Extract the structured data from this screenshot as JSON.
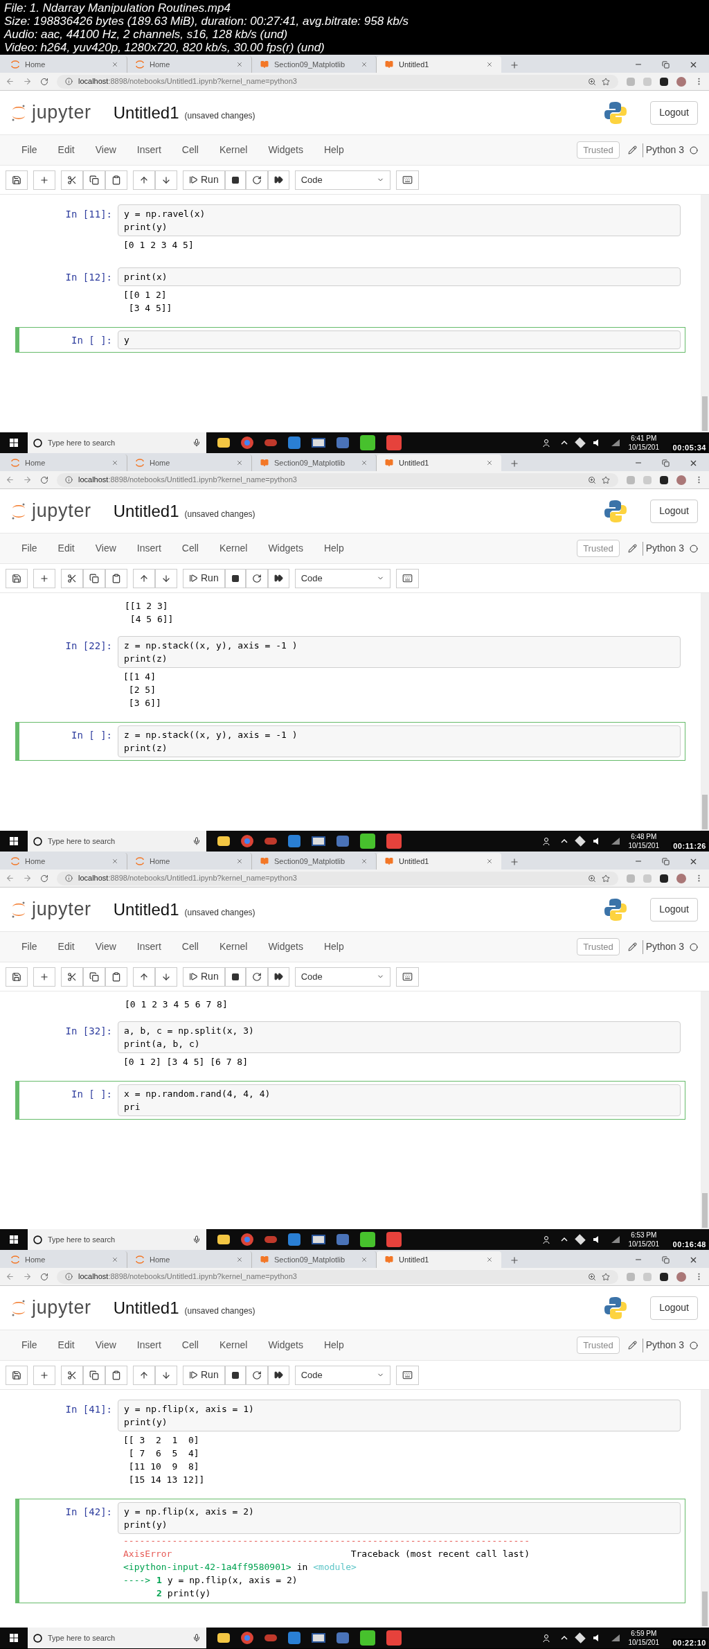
{
  "video_info": [
    "File: 1. Ndarray Manipulation Routines.mp4",
    "Size: 198836426 bytes (189.63 MiB), duration: 00:27:41, avg.bitrate: 958 kb/s",
    "Audio: aac, 44100 Hz, 2 channels, s16, 128 kb/s (und)",
    "Video: h264, yuv420p, 1280x720, 820 kb/s, 30.00 fps(r) (und)"
  ],
  "frames": [
    {
      "browser_tabs": [
        {
          "label": "Home",
          "kind": "home",
          "selected": false
        },
        {
          "label": "Home",
          "kind": "home",
          "selected": false
        },
        {
          "label": "Section09_Matplotlib",
          "kind": "notebook",
          "selected": false
        },
        {
          "label": "Untitled1",
          "kind": "notebook",
          "selected": true
        }
      ],
      "url_host": "localhost",
      "url_path": ":8898/notebooks/Untitled1.ipynb?kernel_name=python3",
      "logo_text": "jupyter",
      "notebook_title": "Untitled1",
      "save_status": "(unsaved changes)",
      "logout": "Logout",
      "menu": [
        "File",
        "Edit",
        "View",
        "Insert",
        "Cell",
        "Kernel",
        "Widgets",
        "Help"
      ],
      "trusted": "Trusted",
      "kernel": "Python 3",
      "run_label": "Run",
      "cell_type": "Code",
      "cells": [
        {
          "kind": "code",
          "prompt": "In [11]:",
          "code": [
            "y = np.ravel(x)",
            "print(y)"
          ],
          "output": [
            "[0 1 2 3 4 5]"
          ],
          "selected": false
        },
        {
          "kind": "code",
          "prompt": "In [12]:",
          "code": [
            "print(x)"
          ],
          "output": [
            "[[0 1 2]",
            " [3 4 5]]"
          ],
          "selected": false
        },
        {
          "kind": "code",
          "prompt": "In [ ]:",
          "code": [
            "y"
          ],
          "selected": true
        }
      ],
      "taskbar": {
        "search": "Type here to search",
        "time": "6:41 PM",
        "date": "10/15/201",
        "elapsed": "00:05:34"
      }
    },
    {
      "browser_tabs": [
        {
          "label": "Home",
          "kind": "home",
          "selected": false
        },
        {
          "label": "Home",
          "kind": "home",
          "selected": false
        },
        {
          "label": "Section09_Matplotlib",
          "kind": "notebook",
          "selected": false
        },
        {
          "label": "Untitled1",
          "kind": "notebook",
          "selected": true
        }
      ],
      "url_host": "localhost",
      "url_path": ":8898/notebooks/Untitled1.ipynb?kernel_name=python3",
      "logo_text": "jupyter",
      "notebook_title": "Untitled1",
      "save_status": "(unsaved changes)",
      "logout": "Logout",
      "menu": [
        "File",
        "Edit",
        "View",
        "Insert",
        "Cell",
        "Kernel",
        "Widgets",
        "Help"
      ],
      "trusted": "Trusted",
      "kernel": "Python 3",
      "run_label": "Run",
      "cell_type": "Code",
      "cells": [
        {
          "kind": "output",
          "output": [
            "[[1 2 3]",
            " [4 5 6]]"
          ]
        },
        {
          "kind": "code",
          "prompt": "In [22]:",
          "code": [
            "z = np.stack((x, y), axis = -1 )",
            "print(z)"
          ],
          "output": [
            "[[1 4]",
            " [2 5]",
            " [3 6]]"
          ],
          "selected": false
        },
        {
          "kind": "code",
          "prompt": "In [ ]:",
          "code": [
            "z = np.stack((x, y), axis = -1 )",
            "print(z)"
          ],
          "selected": true
        }
      ],
      "taskbar": {
        "search": "Type here to search",
        "time": "6:48 PM",
        "date": "10/15/201",
        "elapsed": "00:11:26"
      }
    },
    {
      "browser_tabs": [
        {
          "label": "Home",
          "kind": "home",
          "selected": false
        },
        {
          "label": "Home",
          "kind": "home",
          "selected": false
        },
        {
          "label": "Section09_Matplotlib",
          "kind": "notebook",
          "selected": false
        },
        {
          "label": "Untitled1",
          "kind": "notebook",
          "selected": true
        }
      ],
      "url_host": "localhost",
      "url_path": ":8898/notebooks/Untitled1.ipynb?kernel_name=python3",
      "logo_text": "jupyter",
      "notebook_title": "Untitled1",
      "save_status": "(unsaved changes)",
      "logout": "Logout",
      "menu": [
        "File",
        "Edit",
        "View",
        "Insert",
        "Cell",
        "Kernel",
        "Widgets",
        "Help"
      ],
      "trusted": "Trusted",
      "kernel": "Python 3",
      "run_label": "Run",
      "cell_type": "Code",
      "cells": [
        {
          "kind": "output",
          "output": [
            "[0 1 2 3 4 5 6 7 8]"
          ]
        },
        {
          "kind": "code",
          "prompt": "In [32]:",
          "code": [
            "a, b, c = np.split(x, 3)",
            "print(a, b, c)"
          ],
          "output": [
            "[0 1 2] [3 4 5] [6 7 8]"
          ],
          "selected": false
        },
        {
          "kind": "code",
          "prompt": "In [ ]:",
          "code": [
            "x = np.random.rand(4, 4, 4)",
            "pri"
          ],
          "selected": true
        }
      ],
      "taskbar": {
        "search": "Type here to search",
        "time": "6:53 PM",
        "date": "10/15/201",
        "elapsed": "00:16:48"
      }
    },
    {
      "browser_tabs": [
        {
          "label": "Home",
          "kind": "home",
          "selected": false
        },
        {
          "label": "Home",
          "kind": "home",
          "selected": false
        },
        {
          "label": "Section09_Matplotlib",
          "kind": "notebook",
          "selected": false
        },
        {
          "label": "Untitled1",
          "kind": "notebook",
          "selected": true
        }
      ],
      "url_host": "localhost",
      "url_path": ":8898/notebooks/Untitled1.ipynb?kernel_name=python3",
      "logo_text": "jupyter",
      "notebook_title": "Untitled1",
      "save_status": "(unsaved changes)",
      "logout": "Logout",
      "menu": [
        "File",
        "Edit",
        "View",
        "Insert",
        "Cell",
        "Kernel",
        "Widgets",
        "Help"
      ],
      "trusted": "Trusted",
      "kernel": "Python 3",
      "run_label": "Run",
      "cell_type": "Code",
      "cells": [
        {
          "kind": "code",
          "prompt": "In [41]:",
          "code": [
            "y = np.flip(x, axis = 1)",
            "print(y)"
          ],
          "output": [
            "[[ 3  2  1  0]",
            " [ 7  6  5  4]",
            " [11 10  9  8]",
            " [15 14 13 12]]"
          ],
          "selected": false
        },
        {
          "kind": "code",
          "prompt": "In [42]:",
          "code": [
            "y = np.flip(x, axis = 2)",
            "print(y)"
          ],
          "selected": true,
          "traceback": {
            "dashes": "---------------------------------------------------------------------------",
            "error_name": "AxisError",
            "header": "Traceback (most recent call last)",
            "file": "<ipython-input-42-1a4ff9580901>",
            "in_word": "in",
            "module": "<module>",
            "lines": [
              {
                "arrow": "---->",
                "number": "1",
                "code": "y = np.flip(x, axis = 2)"
              },
              {
                "number": "2",
                "code": "print(y)"
              }
            ]
          }
        }
      ],
      "taskbar": {
        "search": "Type here to search",
        "time": "6:59 PM",
        "date": "10/15/201",
        "elapsed": "00:22:10"
      }
    }
  ]
}
